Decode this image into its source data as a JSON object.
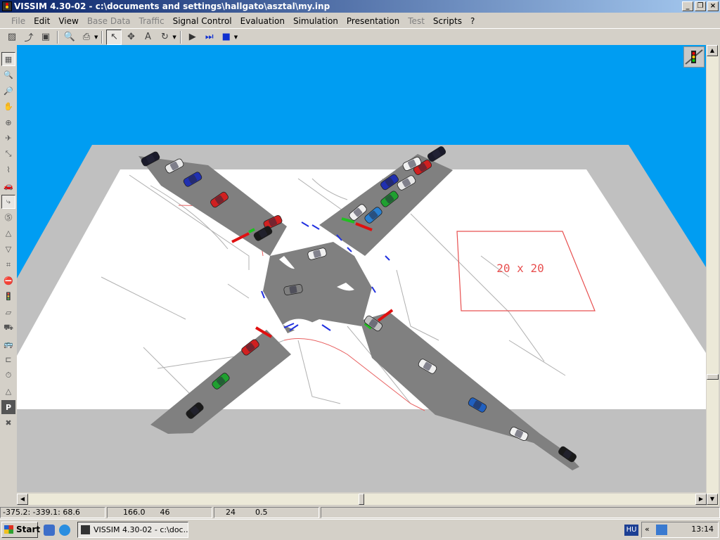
{
  "window": {
    "title": "VISSIM 4.30-02 - c:\\documents and settings\\hallgato\\asztal\\my.inp",
    "minimize_glyph": "_",
    "restore_glyph": "❐",
    "close_glyph": "×"
  },
  "menu": {
    "file": "File",
    "edit": "Edit",
    "view": "View",
    "base_data": "Base Data",
    "traffic": "Traffic",
    "signal_control": "Signal Control",
    "evaluation": "Evaluation",
    "simulation": "Simulation",
    "presentation": "Presentation",
    "test": "Test",
    "scripts": "Scripts",
    "help": "?"
  },
  "scene": {
    "sky_color": "#009df2",
    "ground_color": "#c0c0c0",
    "map_color": "#ffffff",
    "road_color": "#808080",
    "stopline_red": "#e01010",
    "stopline_green": "#20c020",
    "map_box_label": "20 x 20",
    "map_box_color": "#e85050"
  },
  "status": {
    "coords": "-375.2: -339.1: 68.6",
    "cell2": "166.0      46",
    "cell3": "24        0.5"
  },
  "taskbar": {
    "start": "Start",
    "task": "VISSIM 4.30-02 - c:\\doc...",
    "lang": "HU",
    "tray_arrow": "«",
    "clock": "13:14"
  }
}
